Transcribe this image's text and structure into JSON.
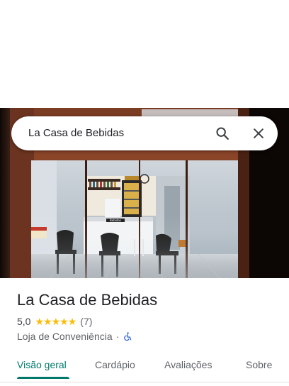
{
  "search": {
    "query": "La Casa de Bebidas"
  },
  "place": {
    "name": "La Casa de Bebidas",
    "rating": "5,0",
    "stars": 5,
    "review_count": "(7)",
    "category": "Loja de Conveniência",
    "separator": "·",
    "wheelchair_accessible": true,
    "interior_sign": "Bebidas"
  },
  "tabs": [
    {
      "label": "Visão geral",
      "active": true
    },
    {
      "label": "Cardápio",
      "active": false
    },
    {
      "label": "Avaliações",
      "active": false
    },
    {
      "label": "Sobre",
      "active": false
    }
  ],
  "colors": {
    "accent": "#00796b",
    "star": "#fbbc04",
    "text_primary": "#202124",
    "text_secondary": "#5f6368"
  },
  "icons": {
    "search": "search-icon",
    "close": "close-icon",
    "accessibility": "wheelchair-icon"
  }
}
